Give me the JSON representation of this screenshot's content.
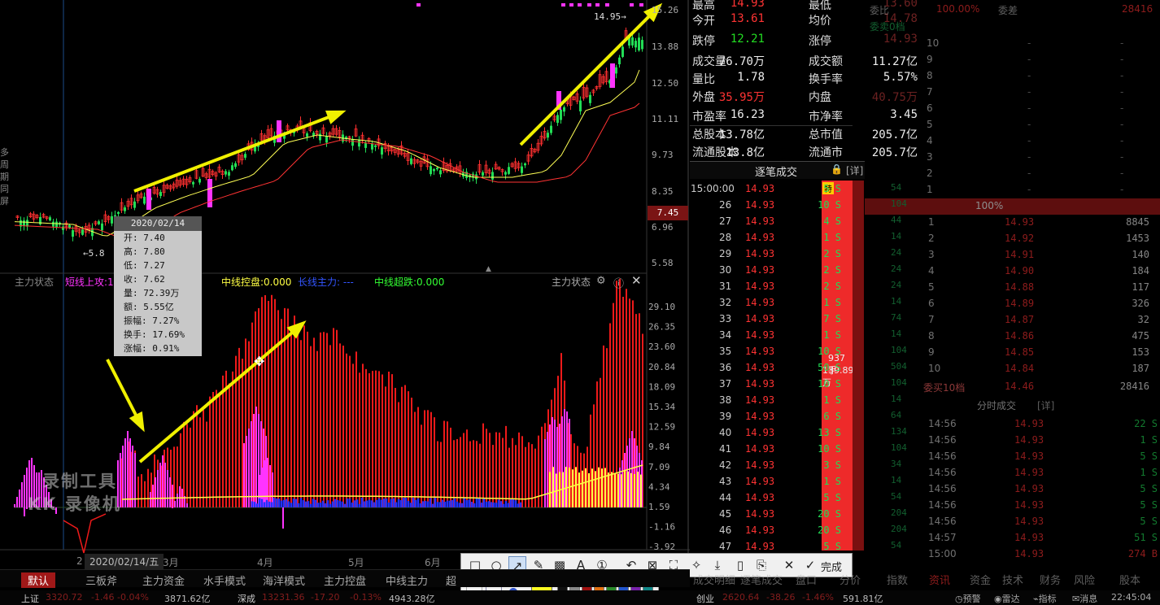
{
  "price_axis": [
    "15.26",
    "13.88",
    "12.50",
    "11.11",
    "9.73",
    "8.35",
    "6.96",
    "5.58"
  ],
  "current_price_tag": "7.45",
  "high_annotation": "14.95",
  "low_annotation": "5.8",
  "indicator_axis": [
    "29.10",
    "26.35",
    "23.60",
    "20.84",
    "18.09",
    "15.34",
    "12.59",
    "9.84",
    "7.09",
    "4.34",
    "1.59",
    "-1.16",
    "-3.92"
  ],
  "indicator": {
    "name": "主力状态",
    "legend_left": "主力状态",
    "legend_items": [
      {
        "text": "短线上攻:10",
        "color": "#ff33ff"
      },
      {
        "text": "中线控盘:0.000",
        "color": "#ffff44"
      },
      {
        "text": "长线主力:  ---",
        "color": "#3355ff"
      },
      {
        "text": "中线超跌:0.000",
        "color": "#33ff33"
      }
    ]
  },
  "x_axis": [
    "2020/02/14/五",
    "3月",
    "4月",
    "5月",
    "6月"
  ],
  "x_axis_left": "2",
  "cursor_popup": {
    "date": "2020/02/14",
    "rows": [
      "开: 7.40",
      "高: 7.80",
      "低: 7.27",
      "收: 7.62",
      "量: 72.39万",
      "额: 5.55亿",
      "振幅: 7.27%",
      "换手: 17.69%",
      "涨幅: 0.91%"
    ]
  },
  "left_side_labels": [
    "多",
    "周",
    "期",
    "同",
    "屏"
  ],
  "watermark": [
    "录制工具",
    "KK 录像机"
  ],
  "quote": {
    "rows": [
      {
        "l1": "最高",
        "v1": "14.93",
        "c1": "red",
        "l2": "最低",
        "v2": "13.60",
        "c2": "red"
      },
      {
        "l1": "今开",
        "v1": "13.61",
        "c1": "red",
        "l2": "均价",
        "v2": "14.78",
        "c2": "red"
      },
      {
        "l1": "跌停",
        "v1": "12.21",
        "c1": "green",
        "l2": "涨停",
        "v2": "14.93",
        "c2": "red"
      },
      {
        "l1": "成交量",
        "v1": "76.70万",
        "c1": "white",
        "l2": "成交额",
        "v2": "11.27亿",
        "c2": "white"
      },
      {
        "l1": "量比",
        "v1": "1.78",
        "c1": "white",
        "l2": "换手率",
        "v2": "5.57%",
        "c2": "white"
      },
      {
        "l1": "外盘",
        "v1": "35.95万",
        "c1": "red",
        "l2": "内盘",
        "v2": "40.75万",
        "c2": "green"
      },
      {
        "l1": "市盈率",
        "v1": "16.23",
        "c1": "white",
        "l2": "市净率",
        "v2": "3.45",
        "c2": "white"
      },
      {
        "l1": "总股本",
        "v1": "13.78亿",
        "c1": "white",
        "l2": "总市值",
        "v2": "205.7亿",
        "c2": "white"
      },
      {
        "l1": "流通股本",
        "v1": "13.8亿",
        "c1": "white",
        "l2": "流通市值",
        "v2": "205.7亿",
        "c2": "white"
      }
    ]
  },
  "tick_panel": {
    "title": "逐笔成交",
    "detail": "[详]",
    "special_tag": "特"
  },
  "ticks": [
    {
      "t": "15:00:00",
      "p": "14.93",
      "v": "5 S"
    },
    {
      "t": "26",
      "p": "14.93",
      "v": "10 S"
    },
    {
      "t": "27",
      "p": "14.93",
      "v": "4 S"
    },
    {
      "t": "28",
      "p": "14.93",
      "v": "1 S"
    },
    {
      "t": "29",
      "p": "14.93",
      "v": "2 S"
    },
    {
      "t": "30",
      "p": "14.93",
      "v": "2 S"
    },
    {
      "t": "31",
      "p": "14.93",
      "v": "2 S"
    },
    {
      "t": "32",
      "p": "14.93",
      "v": "1 S"
    },
    {
      "t": "33",
      "p": "14.93",
      "v": "7 S"
    },
    {
      "t": "34",
      "p": "14.93",
      "v": "1 S"
    },
    {
      "t": "35",
      "p": "14.93",
      "v": "10 S"
    },
    {
      "t": "36",
      "p": "14.93",
      "v": "50 S"
    },
    {
      "t": "37",
      "p": "14.93",
      "v": "10 S"
    },
    {
      "t": "38",
      "p": "14.93",
      "v": "1 S"
    },
    {
      "t": "39",
      "p": "14.93",
      "v": "6 S"
    },
    {
      "t": "40",
      "p": "14.93",
      "v": "13 S"
    },
    {
      "t": "41",
      "p": "14.93",
      "v": "10 S"
    },
    {
      "t": "42",
      "p": "14.93",
      "v": "3 S"
    },
    {
      "t": "43",
      "p": "14.93",
      "v": "1 S"
    },
    {
      "t": "44",
      "p": "14.93",
      "v": "5 S"
    },
    {
      "t": "45",
      "p": "14.93",
      "v": "20 S"
    },
    {
      "t": "46",
      "p": "14.93",
      "v": "20 S"
    },
    {
      "t": "47",
      "p": "14.93",
      "v": "5 S"
    }
  ],
  "redbar_text": [
    "937手",
    "139.89万"
  ],
  "dim_column": [
    "54",
    "104",
    "44",
    "14",
    "24",
    "24",
    "24",
    "14",
    "74",
    "14",
    "104",
    "504",
    "104",
    "14",
    "64",
    "134",
    "104",
    "34",
    "14",
    "54",
    "204",
    "204",
    "54"
  ],
  "order_book": {
    "header": {
      "l1": "委比",
      "v1": "100.00%",
      "l2": "委差",
      "v2": "28416"
    },
    "sell_label": "委卖0档",
    "sell_levels": [
      "10",
      "9",
      "8",
      "7",
      "6",
      "5",
      "4",
      "3",
      "2",
      "1"
    ],
    "mid": "100%",
    "buy_levels": [
      {
        "n": "1",
        "p": "14.93",
        "v": "8845"
      },
      {
        "n": "2",
        "p": "14.92",
        "v": "1453"
      },
      {
        "n": "3",
        "p": "14.91",
        "v": "140"
      },
      {
        "n": "4",
        "p": "14.90",
        "v": "184"
      },
      {
        "n": "5",
        "p": "14.88",
        "v": "117"
      },
      {
        "n": "6",
        "p": "14.89",
        "v": "326"
      },
      {
        "n": "7",
        "p": "14.87",
        "v": "32"
      },
      {
        "n": "8",
        "p": "14.86",
        "v": "475"
      },
      {
        "n": "9",
        "p": "14.85",
        "v": "153"
      },
      {
        "n": "10",
        "p": "14.84",
        "v": "187"
      }
    ],
    "buy_summary": {
      "l": "委买10档",
      "p": "14.46",
      "v": "28416"
    },
    "minute_title": "分时成交",
    "minute_detail": "[详]",
    "minute": [
      {
        "t": "14:56",
        "p": "14.93",
        "v": "22 S"
      },
      {
        "t": "14:56",
        "p": "14.93",
        "v": "1 S"
      },
      {
        "t": "14:56",
        "p": "14.93",
        "v": "5 S"
      },
      {
        "t": "14:56",
        "p": "14.93",
        "v": "1 S"
      },
      {
        "t": "14:56",
        "p": "14.93",
        "v": "5 S"
      },
      {
        "t": "14:56",
        "p": "14.93",
        "v": "5 S"
      },
      {
        "t": "14:56",
        "p": "14.93",
        "v": "5 S"
      },
      {
        "t": "14:57",
        "p": "14.93",
        "v": "51 S"
      },
      {
        "t": "15:00",
        "p": "14.93",
        "v": "274 B"
      }
    ]
  },
  "bottom_tabs": [
    "默认",
    "三板斧",
    "主力资金",
    "水手模式",
    "海洋模式",
    "主力控盘",
    "中线主力",
    "超"
  ],
  "right_bottom_tabs": [
    "成交明细",
    "逐笔成交",
    "盘口",
    "分价",
    "指数",
    "资讯",
    "资金",
    "技术",
    "财务",
    "风险",
    "股本"
  ],
  "toolbar": {
    "done": "完成"
  },
  "status_bar": {
    "sh": "上证",
    "sh_val": "3320.72",
    "sh_chg": "-1.46",
    "sh_pct": "-0.04%",
    "sh_amt": "3871.62亿",
    "sz": "深成",
    "sz_val": "13231.36",
    "sz_chg": "-17.20",
    "sz_pct": "-0.13%",
    "sz_amt": "4943.28亿",
    "cy": "创业",
    "cy_val": "2620.64",
    "cy_chg": "-38.26",
    "cy_pct": "-1.46%",
    "cy_amt": "591.81亿",
    "right": [
      "预警",
      "雷达",
      "指标",
      "消息",
      "22:45:04"
    ]
  },
  "colors": {
    "up": "#ff3030",
    "down": "#22dd55",
    "ma1": "#ffff55",
    "ma2": "#ff3333",
    "arrow": "#f0f000",
    "magenta": "#ff33ff",
    "blue": "#2233ff"
  }
}
